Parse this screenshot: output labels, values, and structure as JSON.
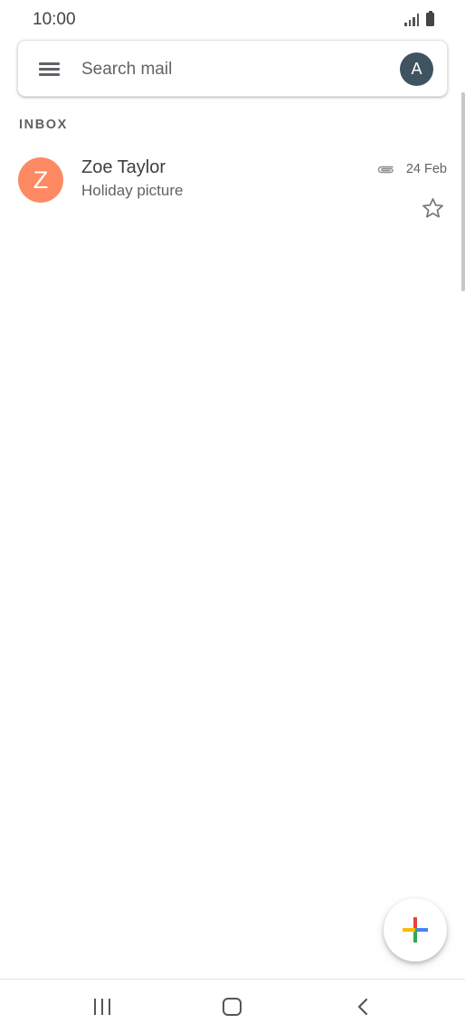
{
  "status_bar": {
    "time": "10:00",
    "icons": [
      "signal-icon",
      "battery-icon"
    ]
  },
  "search": {
    "placeholder": "Search mail",
    "menu_icon": "hamburger-menu-icon",
    "account_initial": "A",
    "account_color": "#3f5360"
  },
  "inbox": {
    "label": "INBOX",
    "emails": [
      {
        "avatar_letter": "Z",
        "avatar_color": "#fd8a63",
        "sender": "Zoe Taylor",
        "subject": "Holiday picture",
        "date": "24 Feb",
        "has_attachment": true,
        "starred": false
      }
    ]
  },
  "compose": {
    "icon": "plus-icon",
    "colors": [
      "#ea4335",
      "#4285f4",
      "#34a853",
      "#fbbc04"
    ]
  },
  "nav_bar": {
    "items": [
      "recents-icon",
      "home-icon",
      "back-icon"
    ]
  }
}
